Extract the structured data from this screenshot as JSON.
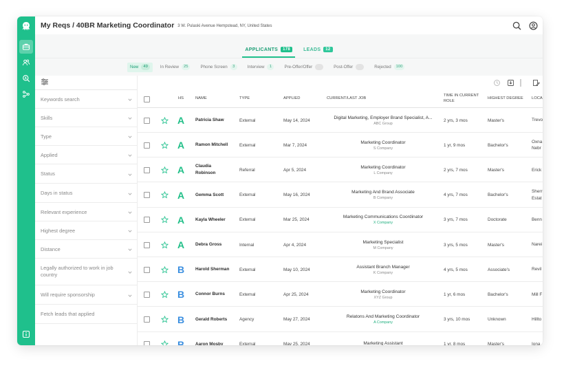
{
  "header": {
    "title": "My Reqs / 40BR Marketing Coordinator",
    "address": "3 W. Pulaski Avenue Hempstead, NY, United States",
    "search_icon": "search-icon",
    "account_icon": "user-circle-icon"
  },
  "rail": {
    "icons": [
      "octopus-logo-icon",
      "briefcase-icon",
      "people-icon",
      "search-person-icon",
      "workflow-icon",
      "info-icon"
    ]
  },
  "main_tabs": [
    {
      "label": "APPLICANTS",
      "count": "178"
    },
    {
      "label": "LEADS",
      "count": "12"
    }
  ],
  "stages": [
    {
      "label": "New",
      "count": "49"
    },
    {
      "label": "In Review",
      "count": "25"
    },
    {
      "label": "Phone Screen",
      "count": "3"
    },
    {
      "label": "Interview",
      "count": "1"
    },
    {
      "label": "Pre-Offer/Offer",
      "count": ""
    },
    {
      "label": "Post-Offer",
      "count": ""
    },
    {
      "label": "Rejected",
      "count": "100"
    }
  ],
  "filters": [
    "Keywords search",
    "Skills",
    "Type",
    "Applied",
    "Status",
    "Days in status",
    "Relevant experience",
    "Highest degree",
    "Distance",
    "Legally authorized to work in job country",
    "Will require sponsorship",
    "Fetch leads that applied"
  ],
  "table": {
    "headers": {
      "hs": "HS",
      "name": "NAME",
      "type": "TYPE",
      "applied": "APPLIED",
      "job": "CURRENT/LAST JOB",
      "time": "TIME IN CURRENT ROLE",
      "degree": "HIGHEST DEGREE",
      "location": "LOCA"
    },
    "rows": [
      {
        "grade": "A",
        "name": "Patricia Shaw",
        "type": "External",
        "applied": "May 14, 2024",
        "job": "Digital Marketing, Employer Brand Specialist, A...",
        "company": "ABC Group",
        "company_link": false,
        "time": "2 yrs, 3 mos",
        "degree": "Master's",
        "location": "Trevo"
      },
      {
        "grade": "A",
        "name": "Ramon Mitchell",
        "type": "External",
        "applied": "Mar 7, 2024",
        "job": "Marketing Coordinator",
        "company": "S Company",
        "company_link": false,
        "time": "1 yr, 9 mos",
        "degree": "Bachelor's",
        "location": "Oxna\nNebr"
      },
      {
        "grade": "A",
        "name": "Claudia\nRobinson",
        "type": "Referral",
        "applied": "Apr 5, 2024",
        "job": "Marketing Coordinator",
        "company": "L Company",
        "company_link": false,
        "time": "2 yrs, 7 mos",
        "degree": "Master's",
        "location": "Erick"
      },
      {
        "grade": "A",
        "name": "Gemma Scott",
        "type": "External",
        "applied": "May 16, 2024",
        "job": "Marketing And Brand Associate",
        "company": "B Company",
        "company_link": false,
        "time": "4 yrs, 7 mos",
        "degree": "Bachelor's",
        "location": "Sherr\nEstat"
      },
      {
        "grade": "A",
        "name": "Kayla Wheeler",
        "type": "External",
        "applied": "Mar 25, 2024",
        "job": "Marketing Communications Coordinator",
        "company": "X Company",
        "company_link": true,
        "time": "3 yrs, 7 mos",
        "degree": "Doctorate",
        "location": "Benn"
      },
      {
        "grade": "A",
        "name": "Debra Gross",
        "type": "Internal",
        "applied": "Apr 4, 2024",
        "job": "Marketing Specialist",
        "company": "M Company",
        "company_link": false,
        "time": "3 yrs, 5 mos",
        "degree": "Master's",
        "location": "Narei"
      },
      {
        "grade": "B",
        "name": "Harold Sherman",
        "type": "External",
        "applied": "May 10, 2024",
        "job": "Assistant Branch Manager",
        "company": "K Company",
        "company_link": false,
        "time": "4 yrs, 5 mos",
        "degree": "Associate's",
        "location": "Revil"
      },
      {
        "grade": "B",
        "name": "Connor Burns",
        "type": "External",
        "applied": "Apr 25, 2024",
        "job": "Marketing Coordinator",
        "company": "XYZ Group",
        "company_link": false,
        "time": "1 yr, 6 mos",
        "degree": "Bachelor's",
        "location": "Mill F"
      },
      {
        "grade": "B",
        "name": "Gerald Roberts",
        "type": "Agency",
        "applied": "May 27, 2024",
        "job": "Relatons And Marketing Coordinator",
        "company": "A Company",
        "company_link": true,
        "time": "3 yrs, 10 mos",
        "degree": "Unknown",
        "location": "Hillto"
      },
      {
        "grade": "B",
        "name": "Aaron Mosby",
        "type": "External",
        "applied": "May 25, 2024",
        "job": "Marketing Assistant",
        "company": "",
        "company_link": false,
        "time": "1 yr, 8 mos",
        "degree": "Master's",
        "location": "Iona"
      }
    ]
  },
  "colors": {
    "accent": "#1fc08c",
    "grade_a": "#21bf88",
    "grade_b": "#3b8fe0"
  }
}
